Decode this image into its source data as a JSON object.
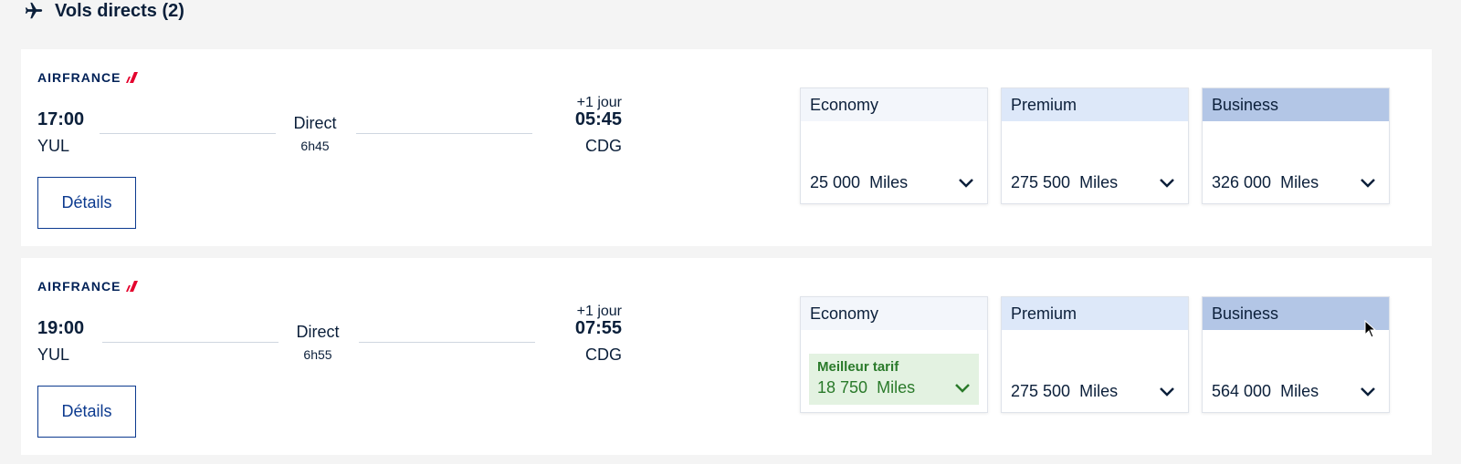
{
  "header": {
    "title": "Vols directs (2)",
    "icon": "airplane-icon"
  },
  "airline": {
    "name": "AIRFRANCE"
  },
  "flights": [
    {
      "dep_time": "17:00",
      "dep_airport": "YUL",
      "stops": "Direct",
      "duration": "6h45",
      "day_offset": "+1 jour",
      "arr_time": "05:45",
      "arr_airport": "CDG",
      "details_label": "Détails",
      "fares": [
        {
          "cabin": "Economy",
          "amount": "25 000",
          "unit": "Miles"
        },
        {
          "cabin": "Premium",
          "amount": "275 500",
          "unit": "Miles"
        },
        {
          "cabin": "Business",
          "amount": "326 000",
          "unit": "Miles"
        }
      ]
    },
    {
      "dep_time": "19:00",
      "dep_airport": "YUL",
      "stops": "Direct",
      "duration": "6h55",
      "day_offset": "+1 jour",
      "arr_time": "07:55",
      "arr_airport": "CDG",
      "details_label": "Détails",
      "fares": [
        {
          "cabin": "Economy",
          "badge": "Meilleur tarif",
          "amount": "18 750",
          "unit": "Miles"
        },
        {
          "cabin": "Premium",
          "amount": "275 500",
          "unit": "Miles"
        },
        {
          "cabin": "Business",
          "amount": "564 000",
          "unit": "Miles"
        }
      ]
    }
  ],
  "colors": {
    "brand_navy": "#002157",
    "link_blue": "#0c3a8f",
    "best_green": "#2a7a2a",
    "best_bg": "#e3f2e1",
    "economy_header": "#f3f6fb",
    "premium_header": "#dde8f9",
    "business_header": "#b3c6e6",
    "air_france_red": "#e4032e"
  }
}
